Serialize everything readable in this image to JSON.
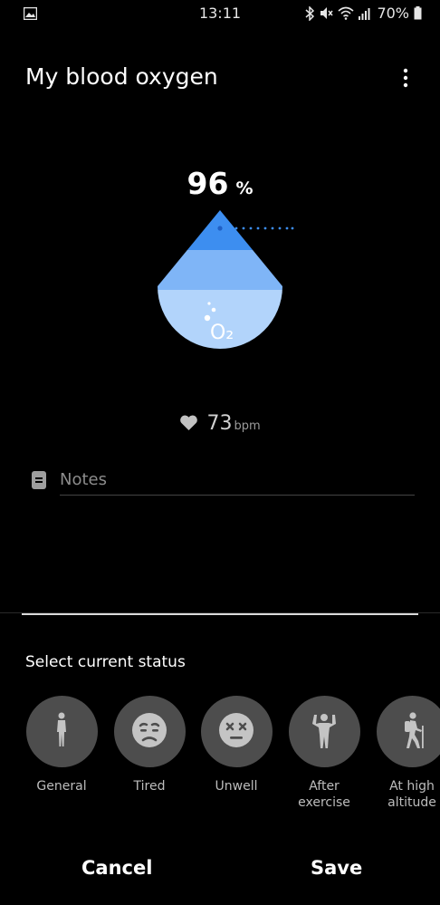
{
  "status_bar": {
    "time": "13:11",
    "battery": "70%",
    "icons": [
      "gallery-icon",
      "bluetooth-icon",
      "mute-icon",
      "wifi-icon",
      "signal-icon",
      "battery-icon"
    ]
  },
  "header": {
    "title": "My blood oxygen",
    "more_icon": "more-vertical-icon"
  },
  "reading": {
    "value": "96",
    "unit": "%",
    "drop_label": "O₂"
  },
  "heart_rate": {
    "value": "73",
    "unit": "bpm"
  },
  "notes": {
    "placeholder": "Notes"
  },
  "status_section": {
    "title": "Select current status",
    "items": [
      {
        "line1": "General",
        "line2": "",
        "icon": "standing-person-icon"
      },
      {
        "line1": "Tired",
        "line2": "",
        "icon": "tired-face-icon"
      },
      {
        "line1": "Unwell",
        "line2": "",
        "icon": "unwell-face-icon"
      },
      {
        "line1": "After",
        "line2": "exercise",
        "icon": "flexing-person-icon"
      },
      {
        "line1": "At high",
        "line2": "altitude",
        "icon": "hiker-icon"
      }
    ]
  },
  "actions": {
    "cancel": "Cancel",
    "save": "Save"
  },
  "colors": {
    "background": "#000000",
    "drop_dark": "#3d8ef0",
    "drop_mid": "#7fb5f7",
    "drop_light": "#b2d4fb",
    "status_circle": "#4d4d4d"
  }
}
